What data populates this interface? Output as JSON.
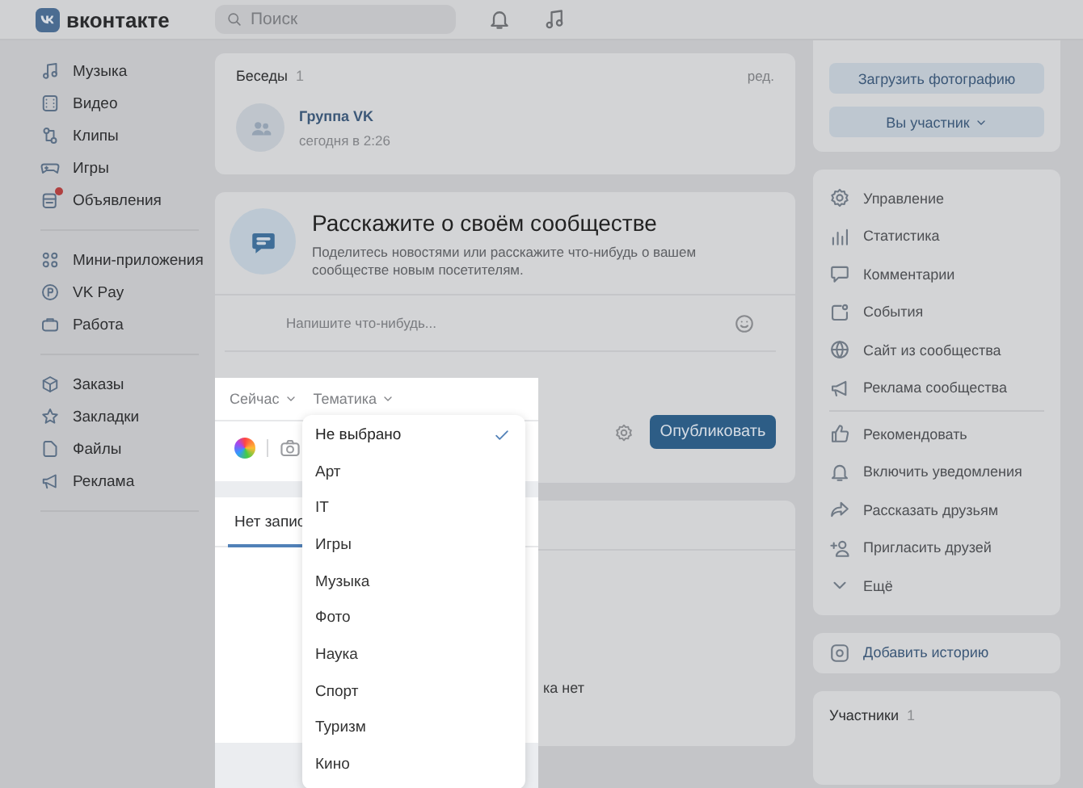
{
  "header": {
    "logo": "вконтакте",
    "search": {
      "placeholder": "Поиск"
    }
  },
  "sidebar": {
    "groups": [
      {
        "items": [
          {
            "label": "Музыка",
            "dot": false
          },
          {
            "label": "Видео",
            "dot": false
          },
          {
            "label": "Клипы",
            "dot": false
          },
          {
            "label": "Игры",
            "dot": false
          },
          {
            "label": "Объявления",
            "dot": true
          }
        ]
      },
      {
        "items": [
          {
            "label": "Мини-приложения",
            "dot": false
          },
          {
            "label": "VK Pay",
            "dot": false
          },
          {
            "label": "Работа",
            "dot": false
          }
        ]
      },
      {
        "items": [
          {
            "label": "Заказы",
            "dot": false
          },
          {
            "label": "Закладки",
            "dot": false
          },
          {
            "label": "Файлы",
            "dot": false
          },
          {
            "label": "Реклама",
            "dot": false
          }
        ]
      }
    ]
  },
  "conversations": {
    "title": "Беседы",
    "count": "1",
    "edit": "ред.",
    "items": [
      {
        "name": "Группа VK",
        "time": "сегодня в 2:26"
      }
    ]
  },
  "composer": {
    "title": "Расскажите о своём сообществе",
    "description": "Поделитесь новостями или расскажите что-нибудь о вашем сообществе новым посетителям.",
    "placeholder": "Напишите что-нибудь...",
    "time_filter": "Сейчас",
    "topic_filter": "Тематика",
    "publish": "Опубликовать"
  },
  "topic_menu": {
    "items": [
      {
        "label": "Не выбрано",
        "selected": true
      },
      {
        "label": "Арт",
        "selected": false
      },
      {
        "label": "IT",
        "selected": false
      },
      {
        "label": "Игры",
        "selected": false
      },
      {
        "label": "Музыка",
        "selected": false
      },
      {
        "label": "Фото",
        "selected": false
      },
      {
        "label": "Наука",
        "selected": false
      },
      {
        "label": "Спорт",
        "selected": false
      },
      {
        "label": "Туризм",
        "selected": false
      },
      {
        "label": "Кино",
        "selected": false
      }
    ]
  },
  "posts": {
    "tab": "Нет запис",
    "empty_text": "ка нет"
  },
  "profile": {
    "upload": "Загрузить фотографию",
    "membership": "Вы участник"
  },
  "actions": {
    "groups": [
      {
        "items": [
          "Управление",
          "Статистика",
          "Комментарии",
          "События",
          "Сайт из сообщества",
          "Реклама сообщества"
        ]
      },
      {
        "items": [
          "Рекомендовать",
          "Включить уведомления",
          "Рассказать друзьям",
          "Пригласить друзей",
          "Ещё"
        ]
      }
    ]
  },
  "story": {
    "label": "Добавить историю"
  },
  "members": {
    "title": "Участники",
    "count": "1"
  }
}
